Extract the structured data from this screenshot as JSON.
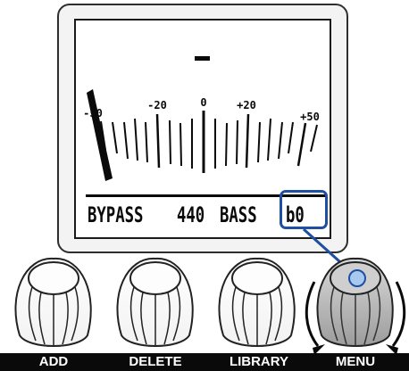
{
  "display": {
    "scale_labels": [
      "-50",
      "-20",
      "0",
      "+20",
      "+50"
    ],
    "status": {
      "bypass": "BYPASS",
      "frequency": "440",
      "mode": "BASS",
      "selected_value": "b0"
    },
    "highlight_color": "#1e4fa0"
  },
  "buttons": [
    {
      "label": "ADD"
    },
    {
      "label": "DELETE"
    },
    {
      "label": "LIBRARY"
    },
    {
      "label": "MENU",
      "active": true
    }
  ]
}
